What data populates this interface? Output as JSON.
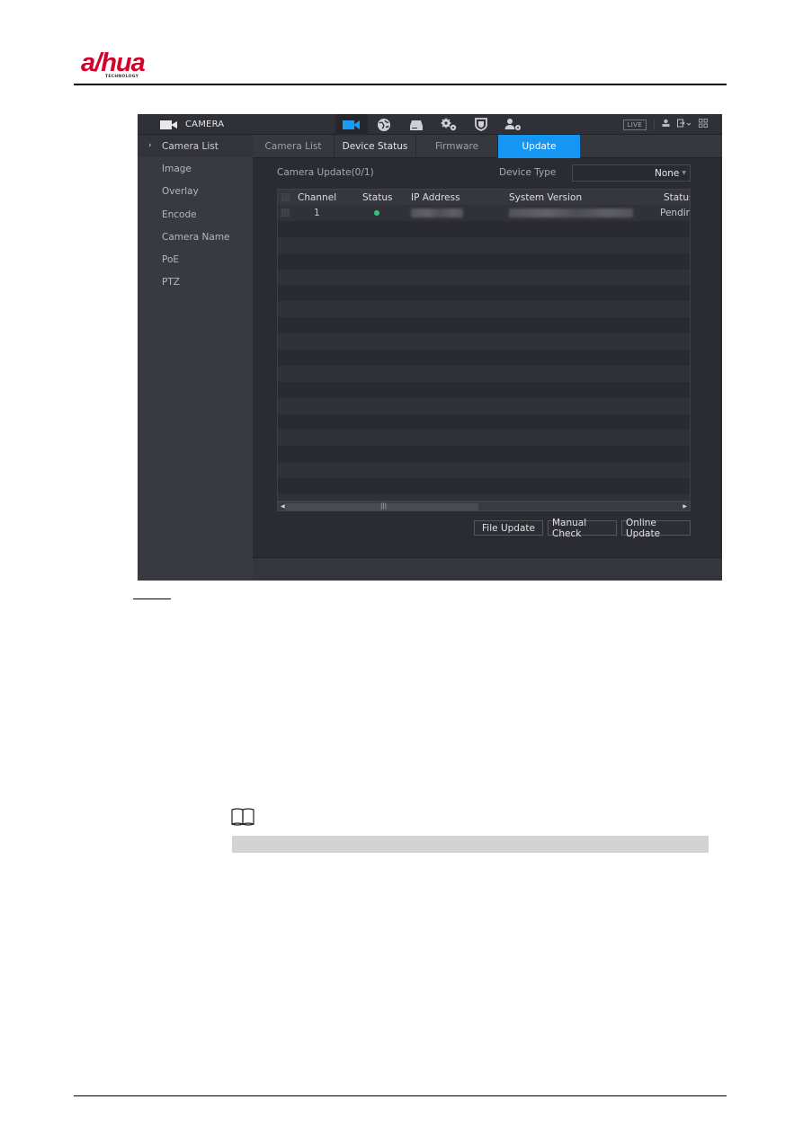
{
  "document": {
    "brand": {
      "logo_text_a": "a",
      "logo_text_rest": "hua",
      "tagline": "TECHNOLOGY",
      "brand_color": "#d3002b"
    },
    "note_icon": "book-note-icon"
  },
  "app": {
    "module_title": "CAMERA",
    "module_icon": "camera-icon",
    "nav_icons": [
      {
        "name": "camera-nav-icon",
        "active": true
      },
      {
        "name": "network-nav-icon",
        "active": false
      },
      {
        "name": "storage-nav-icon",
        "active": false
      },
      {
        "name": "system-settings-nav-icon",
        "active": false
      },
      {
        "name": "security-shield-nav-icon",
        "active": false
      },
      {
        "name": "account-settings-nav-icon",
        "active": false
      }
    ],
    "live_label": "LIVE",
    "topright_icons": [
      "user-icon",
      "logout-icon",
      "grid-menu-icon"
    ],
    "accent_color": "#1496f2"
  },
  "sidebar": {
    "items": [
      {
        "label": "Camera List",
        "active": true
      },
      {
        "label": "Image"
      },
      {
        "label": "Overlay"
      },
      {
        "label": "Encode"
      },
      {
        "label": "Camera Name"
      },
      {
        "label": "PoE"
      },
      {
        "label": "PTZ"
      }
    ]
  },
  "tabs": [
    {
      "label": "Camera List"
    },
    {
      "label": "Device Status"
    },
    {
      "label": "Firmware"
    },
    {
      "label": "Update",
      "active": true
    }
  ],
  "update_panel": {
    "camera_update_label": "Camera Update(0/1)",
    "device_type_label": "Device Type",
    "device_type_value": "None",
    "table": {
      "headers": [
        "Channel",
        "Status",
        "IP Address",
        "System Version",
        "Status"
      ],
      "rows": [
        {
          "channel": "1",
          "status": "online",
          "status_color": "#2ec774",
          "ip_address": "[blurred]",
          "system_version": "[blurred]",
          "update_status": "Pendin"
        }
      ]
    },
    "buttons": {
      "file_update": "File Update",
      "manual_check": "Manual Check",
      "online_update": "Online Update"
    }
  }
}
